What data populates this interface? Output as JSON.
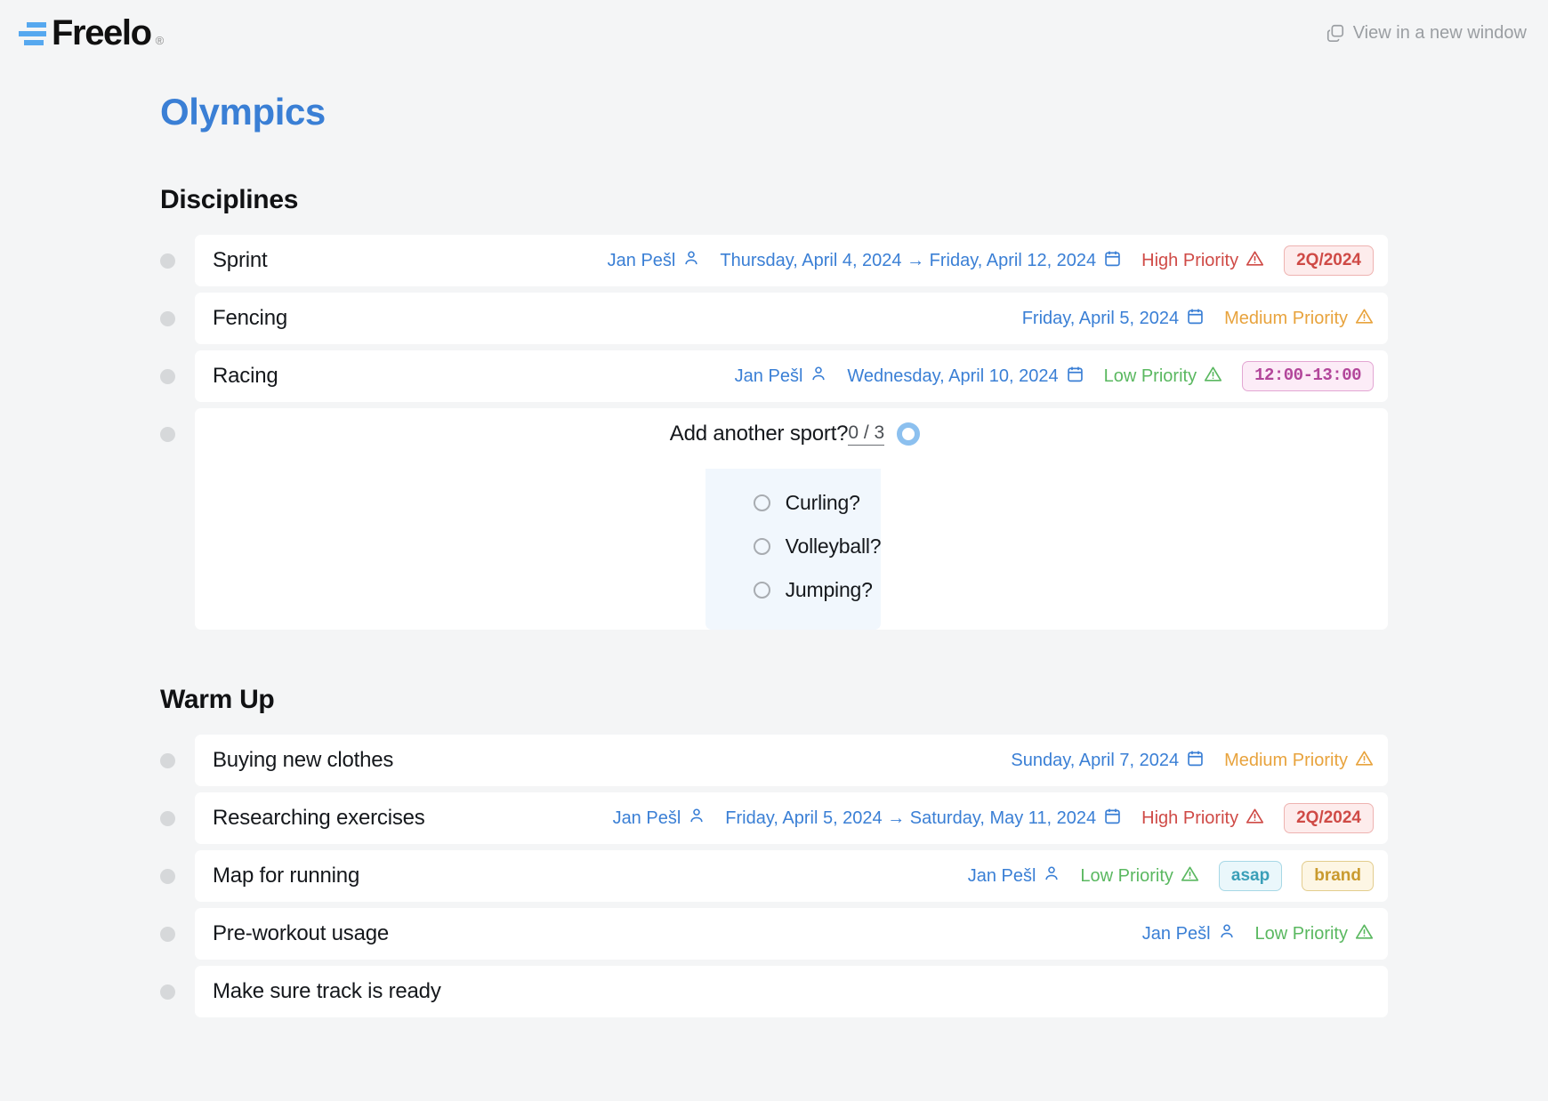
{
  "app": {
    "brand_name": "Freelo",
    "brand_registered": "®",
    "brand_color": "#56a8ef",
    "new_window_label": "View in a new window",
    "new_window_icon": "copy-window-icon"
  },
  "project": {
    "title": "Olympics",
    "title_color": "#3a7fd5"
  },
  "sections": [
    {
      "heading": "Disciplines",
      "tasks": [
        {
          "name": "Sprint",
          "assignee": "Jan Pešl",
          "due": "Thursday, April 4, 2024 → Friday, April 12, 2024",
          "priority": "High Priority",
          "priority_level": "high",
          "priority_color": "#cf4a46",
          "badges": [
            {
              "label": "2Q/2024",
              "style": "quarter"
            }
          ]
        },
        {
          "name": "Fencing",
          "assignee": null,
          "due": "Friday, April 5, 2024",
          "priority": "Medium Priority",
          "priority_level": "medium",
          "priority_color": "#e8a33d",
          "badges": []
        },
        {
          "name": "Racing",
          "assignee": "Jan Pešl",
          "due": "Wednesday, April 10, 2024",
          "priority": "Low Priority",
          "priority_level": "low",
          "priority_color": "#5ab860",
          "badges": [
            {
              "label": "12:00-13:00",
              "style": "time"
            }
          ]
        }
      ],
      "checklist": {
        "name": "Add another sport?",
        "progress_count": "0 / 3",
        "progress_done": 0,
        "progress_total": 3,
        "items": [
          {
            "label": "Curling?",
            "checked": false
          },
          {
            "label": "Volleyball?",
            "checked": false
          },
          {
            "label": "Jumping?",
            "checked": false
          }
        ]
      }
    },
    {
      "heading": "Warm Up",
      "tasks": [
        {
          "name": "Buying new clothes",
          "assignee": null,
          "due": "Sunday, April 7, 2024",
          "priority": "Medium Priority",
          "priority_level": "medium",
          "priority_color": "#e8a33d",
          "badges": []
        },
        {
          "name": "Researching exercises",
          "assignee": "Jan Pešl",
          "due": "Friday, April 5, 2024 → Saturday, May 11, 2024",
          "priority": "High Priority",
          "priority_level": "high",
          "priority_color": "#cf4a46",
          "badges": [
            {
              "label": "2Q/2024",
              "style": "quarter"
            }
          ]
        },
        {
          "name": "Map for running",
          "assignee": "Jan Pešl",
          "due": null,
          "priority": "Low Priority",
          "priority_level": "low",
          "priority_color": "#5ab860",
          "badges": [
            {
              "label": "asap",
              "style": "asap"
            },
            {
              "label": "brand",
              "style": "brand"
            }
          ]
        },
        {
          "name": "Pre-workout usage",
          "assignee": "Jan Pešl",
          "due": null,
          "priority": "Low Priority",
          "priority_level": "low",
          "priority_color": "#5ab860",
          "badges": []
        },
        {
          "name": "Make sure track is ready",
          "assignee": null,
          "due": null,
          "priority": null,
          "priority_level": null,
          "priority_color": null,
          "badges": []
        }
      ],
      "checklist": null
    }
  ],
  "icons": {
    "assignee": "person-icon",
    "due": "calendar-icon",
    "priority": "warning-triangle-icon",
    "bullet": "task-bullet-icon"
  }
}
